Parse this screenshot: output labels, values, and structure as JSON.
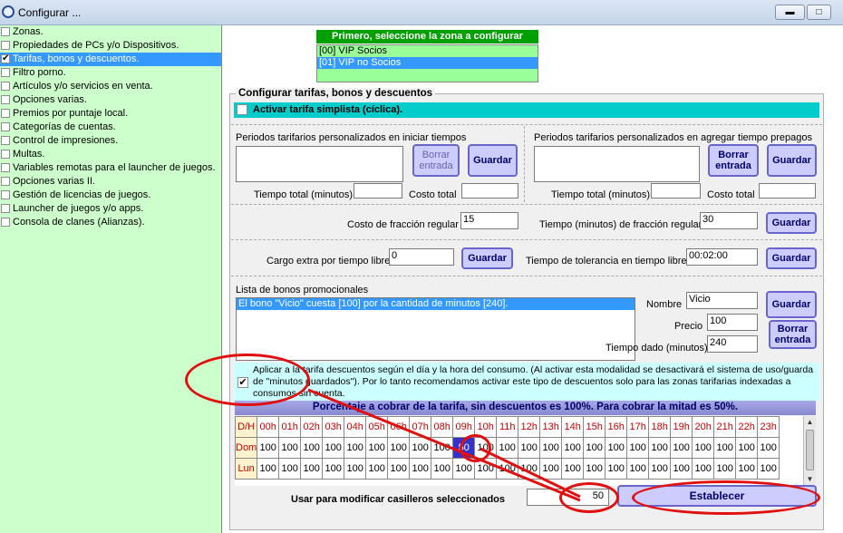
{
  "window": {
    "title": "Configurar ...",
    "min_icon": "minimize-icon",
    "max_icon": "maximize-icon",
    "close_icon": "close-icon"
  },
  "sidebar": {
    "items": [
      {
        "label": "Zonas.",
        "checked": false
      },
      {
        "label": "Propiedades de PCs y/o Dispositivos.",
        "checked": false
      },
      {
        "label": "Tarifas, bonos y descuentos.",
        "checked": true
      },
      {
        "label": "Filtro porno.",
        "checked": false
      },
      {
        "label": "Artículos y/o servicios en venta.",
        "checked": false
      },
      {
        "label": "Opciones varias.",
        "checked": false
      },
      {
        "label": "Premios por puntaje local.",
        "checked": false
      },
      {
        "label": "Categorías de cuentas.",
        "checked": false
      },
      {
        "label": "Control de impresiones.",
        "checked": false
      },
      {
        "label": "Multas.",
        "checked": false
      },
      {
        "label": "Variables remotas para el launcher de juegos.",
        "checked": false
      },
      {
        "label": "Opciones varias II.",
        "checked": false
      },
      {
        "label": "Gestión de licencias de juegos.",
        "checked": false
      },
      {
        "label": "Launcher de juegos y/o apps.",
        "checked": false
      },
      {
        "label": "Consola de clanes (Alianzas).",
        "checked": false
      }
    ]
  },
  "zones": {
    "header": "Primero, seleccione la zona a configurar",
    "items": [
      "[00] VIP Socios",
      "[01] VIP no Socios"
    ]
  },
  "config": {
    "group_title": "Configurar tarifas, bonos y descuentos",
    "simple_rate_label": "Activar tarifa simplista (cíclica).",
    "period_start": {
      "title": "Periodos tarifarios personalizados en iniciar tiempos",
      "delete_label": "Borrar entrada",
      "save_label": "Guardar",
      "total_time_label": "Tiempo total (minutos)",
      "total_time_value": "",
      "total_cost_label": "Costo total",
      "total_cost_value": ""
    },
    "period_prepaid": {
      "title": "Periodos tarifarios personalizados en agregar tiempo prepagos",
      "delete_label": "Borrar entrada",
      "save_label": "Guardar",
      "total_time_label": "Tiempo total (minutos)",
      "total_time_value": "",
      "total_cost_label": "Costo total",
      "total_cost_value": ""
    },
    "fraction": {
      "cost_label": "Costo de fracción regular",
      "cost_value": "15",
      "time_label": "Tiempo (minutos) de fracción regular",
      "time_value": "30",
      "save_label": "Guardar"
    },
    "extra": {
      "charge_label": "Cargo extra por tiempo libre",
      "charge_value": "0",
      "save_label": "Guardar",
      "tolerance_label": "Tiempo de tolerancia en tiempo libre",
      "tolerance_value": "00:02:00",
      "save2_label": "Guardar"
    },
    "bonos": {
      "title": "Lista de bonos promocionales",
      "items": [
        "El bono \"Vicio\" cuesta [100] por la cantidad de minutos [240]."
      ],
      "name_label": "Nombre",
      "name_value": "Vicio",
      "price_label": "Precio",
      "price_value": "100",
      "time_label": "Tiempo dado (minutos)",
      "time_value": "240",
      "save_label": "Guardar",
      "delete_label": "Borrar entrada"
    },
    "discounts": {
      "checked": true,
      "text": "Aplicar a la tarifa descuentos según el día y la hora del consumo. (Al activar esta modalidad se desactivará el sistema de uso/guarda de \"minutos guardados\"). Por lo tanto recomendamos activar este tipo de descuentos solo para las zonas tarifarias indexadas a consumos sin cuenta.",
      "percent_header": "Porcentaje a cobrar de la tarifa, sin descuentos es 100%. Para cobrar la mitad es 50%.",
      "corner_label": "D/H",
      "hours": [
        "00h",
        "01h",
        "02h",
        "03h",
        "04h",
        "05h",
        "06h",
        "07h",
        "08h",
        "09h",
        "10h",
        "11h",
        "12h",
        "13h",
        "14h",
        "15h",
        "16h",
        "17h",
        "18h",
        "19h",
        "20h",
        "21h",
        "22h",
        "23h"
      ],
      "rows": [
        {
          "day": "Dom",
          "values": [
            "100",
            "100",
            "100",
            "100",
            "100",
            "100",
            "100",
            "100",
            "100",
            "50",
            "100",
            "100",
            "100",
            "100",
            "100",
            "100",
            "100",
            "100",
            "100",
            "100",
            "100",
            "100",
            "100",
            "100"
          ]
        },
        {
          "day": "Lun",
          "values": [
            "100",
            "100",
            "100",
            "100",
            "100",
            "100",
            "100",
            "100",
            "100",
            "100",
            "100",
            "100",
            "100",
            "100",
            "100",
            "100",
            "100",
            "100",
            "100",
            "100",
            "100",
            "100",
            "100",
            "100"
          ]
        }
      ],
      "modify_label": "Usar para modificar casilleros seleccionados",
      "modify_value": "50",
      "apply_label": "Establecer"
    }
  }
}
